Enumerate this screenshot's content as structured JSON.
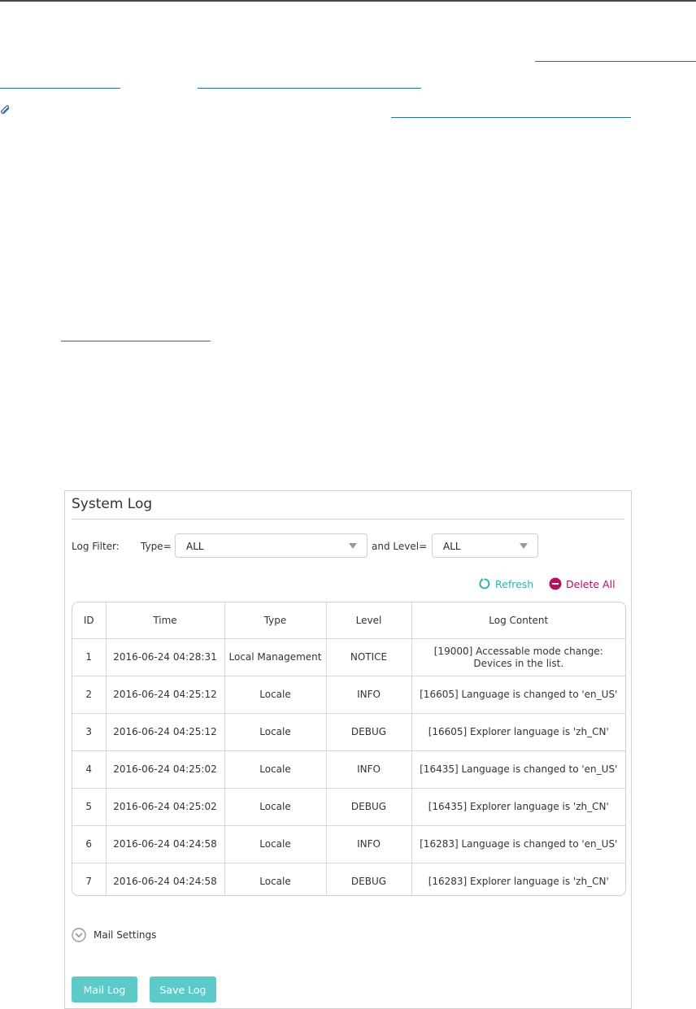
{
  "panel": {
    "title": "System Log",
    "filter": {
      "label": "Log Filter:",
      "type_label": "Type=",
      "type_value": "ALL",
      "level_label": "and Level=",
      "level_value": "ALL"
    },
    "actions": {
      "refresh_label": "Refresh",
      "delete_all_label": "Delete All"
    },
    "table": {
      "headers": [
        "ID",
        "Time",
        "Type",
        "Level",
        "Log Content"
      ],
      "rows": [
        [
          "1",
          "2016-06-24 04:28:31",
          "Local Management",
          "NOTICE",
          "[19000] Accessable mode change: Devices in the list."
        ],
        [
          "2",
          "2016-06-24 04:25:12",
          "Locale",
          "INFO",
          "[16605] Language is changed to 'en_US'"
        ],
        [
          "3",
          "2016-06-24 04:25:12",
          "Locale",
          "DEBUG",
          "[16605] Explorer language is 'zh_CN'"
        ],
        [
          "4",
          "2016-06-24 04:25:02",
          "Locale",
          "INFO",
          "[16435] Language is changed to 'en_US'"
        ],
        [
          "5",
          "2016-06-24 04:25:02",
          "Locale",
          "DEBUG",
          "[16435] Explorer language is 'zh_CN'"
        ],
        [
          "6",
          "2016-06-24 04:24:58",
          "Locale",
          "INFO",
          "[16283] Language is changed to 'en_US'"
        ],
        [
          "7",
          "2016-06-24 04:24:58",
          "Locale",
          "DEBUG",
          "[16283] Explorer language is 'zh_CN'"
        ]
      ]
    },
    "mail_settings_label": "Mail Settings",
    "buttons": {
      "mail_log": "Mail Log",
      "save_log": "Save Log"
    }
  },
  "colors": {
    "accent": "#5ccac8",
    "refresh": "#35b2b2",
    "delete": "#b0135a",
    "link": "#2a6ea6"
  },
  "icons": {
    "attachment": "paperclip-icon",
    "refresh": "refresh-icon",
    "delete": "minus-circle-icon",
    "mail_settings": "chevron-down-circle-icon"
  }
}
